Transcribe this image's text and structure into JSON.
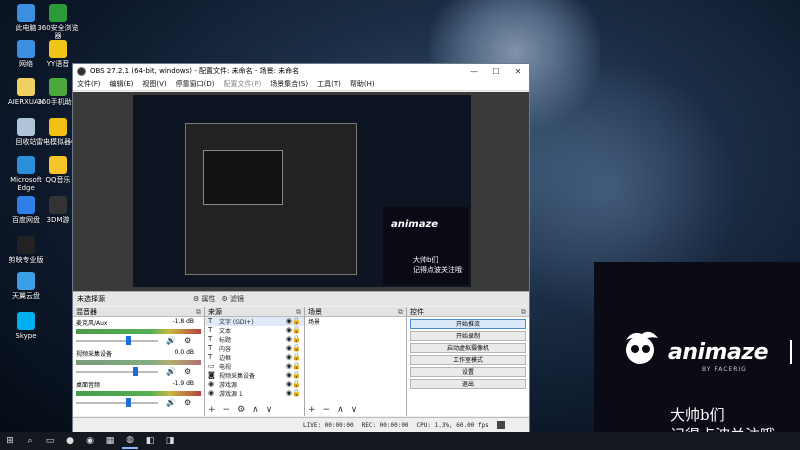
{
  "desktop": {
    "icons": [
      {
        "label": "此电脑",
        "color": "#3c8ee0"
      },
      {
        "label": "360安全浏览器",
        "color": "#2d9a3a"
      },
      {
        "label": "网络",
        "color": "#3c8ee0"
      },
      {
        "label": "YY语音",
        "color": "#f0c419"
      },
      {
        "label": "AIERXUAN",
        "color": "#f0d060"
      },
      {
        "label": "360手机助手",
        "color": "#4aa83f"
      },
      {
        "label": "回收站",
        "color": "#b0c4d8"
      },
      {
        "label": "雷电模拟器64",
        "color": "#f2c012"
      },
      {
        "label": "Microsoft Edge",
        "color": "#2a8fd8"
      },
      {
        "label": "QQ音乐",
        "color": "#f7c528"
      },
      {
        "label": "百度网盘",
        "color": "#2f7fe8"
      },
      {
        "label": "3DM游",
        "color": "#333333"
      },
      {
        "label": "剪映专业版",
        "color": "#222222"
      },
      {
        "label": "天翼云盘",
        "color": "#3c9ee8"
      },
      {
        "label": "Skype",
        "color": "#00aff0"
      }
    ]
  },
  "obs": {
    "title": "OBS 27.2.1 (64-bit, windows) - 配置文件: 未命名 - 场景: 未命名",
    "window_buttons": [
      "—",
      "☐",
      "✕"
    ],
    "menu": [
      {
        "label": "文件(F)",
        "enabled": true
      },
      {
        "label": "编辑(E)",
        "enabled": true
      },
      {
        "label": "视图(V)",
        "enabled": true
      },
      {
        "label": "停靠窗口(D)",
        "enabled": true
      },
      {
        "label": "配置文件(P)",
        "enabled": false
      },
      {
        "label": "场景集合(S)",
        "enabled": true
      },
      {
        "label": "工具(T)",
        "enabled": true
      },
      {
        "label": "帮助(H)",
        "enabled": true
      }
    ],
    "preview": {
      "brand": "animaze",
      "line1": "大帅b们",
      "line2": "记得点波关注哦"
    },
    "scene_bar": {
      "name": "未选择源",
      "properties": "属性",
      "filters": "滤镜"
    },
    "mixer": {
      "title": "混音器",
      "channels": [
        {
          "name": "麦克风/Aux",
          "db": "-1.8 dB",
          "level": 0.64,
          "active": true
        },
        {
          "name": "视频采集设备",
          "db": "0.0 dB",
          "level": 0.72,
          "active": false
        },
        {
          "name": "桌面音频",
          "db": "-1.9 dB",
          "level": 0.63,
          "active": true
        }
      ]
    },
    "sources": {
      "title": "来源",
      "items": [
        {
          "name": "文字 (GDI+)",
          "icon": "T"
        },
        {
          "name": "文本",
          "icon": "T"
        },
        {
          "name": "标题",
          "icon": "T"
        },
        {
          "name": "内容",
          "icon": "T"
        },
        {
          "name": "边框",
          "icon": "T"
        },
        {
          "name": "电视",
          "icon": "▭"
        },
        {
          "name": "视频采集设备",
          "icon": "◙"
        },
        {
          "name": "游戏源",
          "icon": "◉"
        },
        {
          "name": "游戏源 1",
          "icon": "◉"
        }
      ]
    },
    "scenes": {
      "title": "场景",
      "items": [
        "场景"
      ]
    },
    "controls": {
      "title": "控件",
      "buttons": [
        "开始推流",
        "开始录制",
        "启动虚拟摄像机",
        "工作室模式",
        "设置",
        "退出"
      ]
    },
    "status": {
      "live": "LIVE: 00:00:00",
      "rec": "REC: 00:00:00",
      "cpu": "CPU: 1.3%, 60.00 fps"
    }
  },
  "overlay": {
    "brand": "animaze",
    "by": "BY FACERIG",
    "line1": "大帅b们",
    "line2": "记得点波关注哦"
  },
  "taskbar": {
    "items": [
      {
        "name": "windows-start-icon",
        "glyph": "⊞",
        "active": false
      },
      {
        "name": "search-icon",
        "glyph": "⌕",
        "active": false
      },
      {
        "name": "task-view-icon",
        "glyph": "▭",
        "active": false
      },
      {
        "name": "edge-icon",
        "glyph": "●",
        "active": false
      },
      {
        "name": "browser-icon",
        "glyph": "◉",
        "active": false
      },
      {
        "name": "store-icon",
        "glyph": "▦",
        "active": false
      },
      {
        "name": "obs-icon",
        "glyph": "◍",
        "active": true
      },
      {
        "name": "app-icon",
        "glyph": "◧",
        "active": false
      },
      {
        "name": "app2-icon",
        "glyph": "◨",
        "active": false
      }
    ]
  }
}
